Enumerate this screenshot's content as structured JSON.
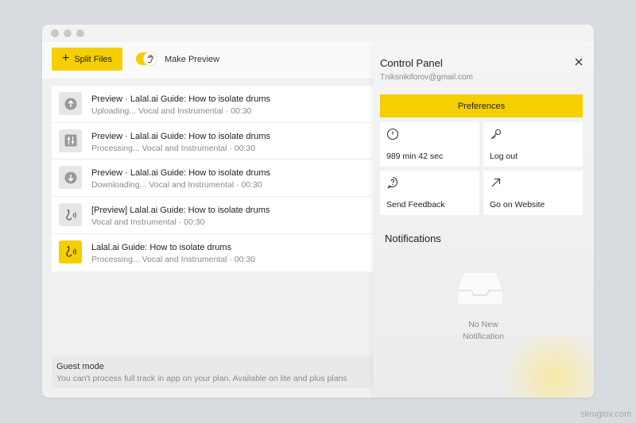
{
  "toolbar": {
    "split_label": "Split Files",
    "preview_label": "Make Preview",
    "preview_on": true
  },
  "files": [
    {
      "title": "Preview · Lalal.ai Guide: How to isolate drums",
      "subtitle": "Uploading... Vocal and Instrumental · 00:30",
      "icon": "upload-icon"
    },
    {
      "title": "Preview · Lalal.ai Guide: How to isolate drums",
      "subtitle": "Processing... Vocal and Instrumental · 00:30",
      "icon": "processing-icon"
    },
    {
      "title": "Preview · Lalal.ai Guide: How to isolate drums",
      "subtitle": "Downloading... Vocal and Instrumental · 00:30",
      "icon": "download-icon"
    },
    {
      "title": "[Preview] Lalal.ai Guide: How to isolate drums",
      "subtitle": "Vocal and Instrumental · 00:30",
      "icon": "audio-icon"
    },
    {
      "title": "Lalal.ai Guide: How to isolate drums",
      "subtitle": "Processing... Vocal and Instrumental · 00:30",
      "icon": "audio-icon"
    }
  ],
  "guest": {
    "title": "Guest mode",
    "text": "You can't process full track in app on your plan. Available on lite and plus plans"
  },
  "panel": {
    "title": "Control Panel",
    "email": "Tniksnikiforov@gmail.com",
    "preferences_label": "Preferences",
    "tiles": [
      {
        "label": "989 min 42 sec",
        "icon": "clock-icon"
      },
      {
        "label": "Log out",
        "icon": "key-icon"
      },
      {
        "label": "Send Feedback",
        "icon": "feedback-icon"
      },
      {
        "label": "Go on Website",
        "icon": "external-link-icon"
      }
    ],
    "notifications_title": "Notifications",
    "empty_line1": "No New",
    "empty_line2": "Notification"
  },
  "watermark": "skruglov.com",
  "colors": {
    "accent": "#f5cf00",
    "background": "#d8dce0",
    "muted_text": "#8a8a8a"
  }
}
